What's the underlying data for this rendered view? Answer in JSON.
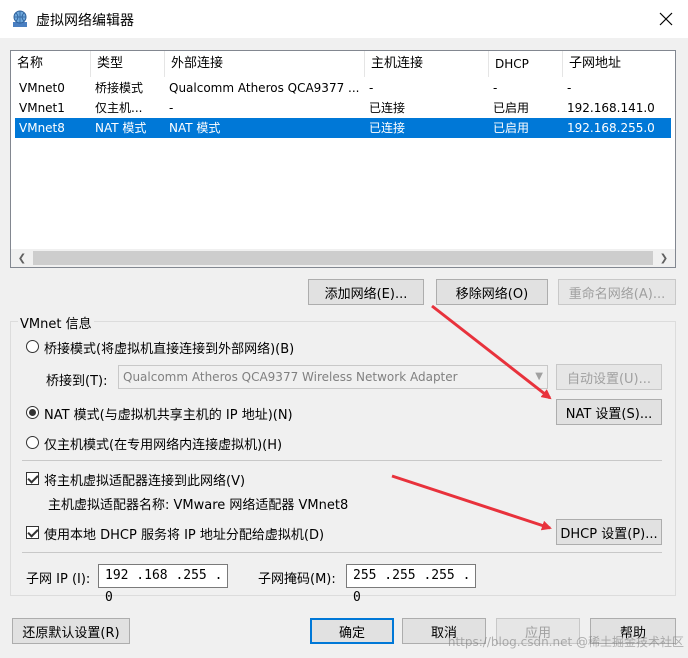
{
  "window": {
    "title": "虚拟网络编辑器"
  },
  "table": {
    "columns": [
      "名称",
      "类型",
      "外部连接",
      "主机连接",
      "DHCP",
      "子网地址"
    ],
    "rows": [
      {
        "name": "VMnet0",
        "type": "桥接模式",
        "external": "Qualcomm Atheros QCA9377 ...",
        "host": "-",
        "dhcp": "-",
        "subnet": "-"
      },
      {
        "name": "VMnet1",
        "type": "仅主机...",
        "external": "-",
        "host": "已连接",
        "dhcp": "已启用",
        "subnet": "192.168.141.0"
      },
      {
        "name": "VMnet8",
        "type": "NAT 模式",
        "external": "NAT 模式",
        "host": "已连接",
        "dhcp": "已启用",
        "subnet": "192.168.255.0"
      }
    ],
    "selected_row": 2
  },
  "list_buttons": {
    "add": "添加网络(E)...",
    "remove": "移除网络(O)",
    "rename": "重命名网络(A)..."
  },
  "vmnet_info": {
    "group_label": "VMnet 信息",
    "bridged_label": "桥接模式(将虚拟机直接连接到外部网络)(B)",
    "bridged_to_label": "桥接到(T):",
    "bridged_to_value": "Qualcomm Atheros QCA9377 Wireless Network Adapter",
    "auto_settings": "自动设置(U)...",
    "nat_label": "NAT 模式(与虚拟机共享主机的 IP 地址)(N)",
    "nat_settings": "NAT 设置(S)...",
    "hostonly_label": "仅主机模式(在专用网络内连接虚拟机)(H)",
    "connect_adapter_label": "将主机虚拟适配器连接到此网络(V)",
    "adapter_name_label": "主机虚拟适配器名称: VMware 网络适配器 VMnet8",
    "dhcp_label": "使用本地 DHCP 服务将 IP 地址分配给虚拟机(D)",
    "dhcp_settings": "DHCP 设置(P)...",
    "subnet_ip_label": "子网 IP (I):",
    "subnet_ip_value": "192 .168 .255 . 0",
    "subnet_mask_label": "子网掩码(M):",
    "subnet_mask_value": "255 .255 .255 . 0"
  },
  "footer": {
    "restore": "还原默认设置(R)",
    "ok": "确定",
    "cancel": "取消",
    "apply": "应用",
    "help": "帮助"
  },
  "watermark": "https://blog.csdn.net @稀土掘金技术社区",
  "colors": {
    "selection": "#0078d7",
    "arrow": "#e8323c"
  }
}
